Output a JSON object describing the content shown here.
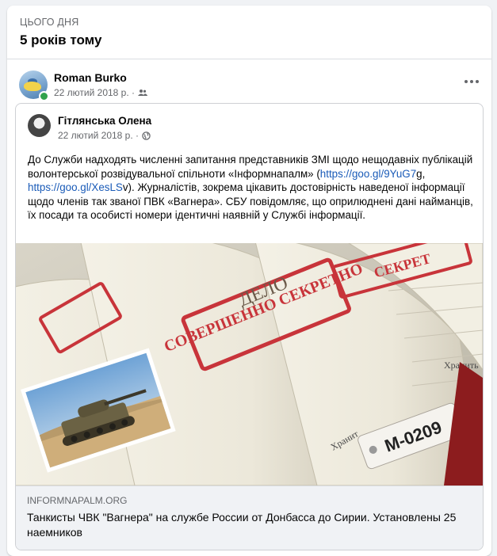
{
  "memories": {
    "eyebrow": "ЦЬОГО ДНЯ",
    "years_ago": "5 років тому"
  },
  "post": {
    "author": "Roman Burko",
    "date": "22 лютий 2018 р. ·",
    "audience_icon": "friends-icon",
    "more_icon": "more-horizontal-icon"
  },
  "shared_post": {
    "author": "Гітлянська Олена",
    "date": "22 лютий 2018 р. ·",
    "audience_icon": "globe-icon",
    "text_part1": "До Служби надходять  численні запитання представників ЗМІ щодо нещодавніх публікацій волонтерської розвідувальної спільноти «Інформнапалм» (",
    "link1": "https://goo.gl/9YuG7",
    "text_part2": "g, ",
    "link2": "https://goo.gl/XesLS",
    "text_part3": "v). Журналістів, зокрема цікавить достовірність наведеної інформації щодо членів так званої ПВК «Вагнера».  СБУ повідомляє, що оприлюднені дані найманців, їх посади та особисті номери ідентичні наявній у Службі інформації."
  },
  "image": {
    "stamp1": "СОВЕРШЕННО СЕКРЕТНО",
    "stamp2": "ДЕЛО",
    "stamp3": "СЕКРЕТ",
    "keep1": "Хранить",
    "keep2": "Хранит",
    "tag": "М-0209"
  },
  "link_preview": {
    "domain": "INFORMNAPALM.ORG",
    "title": "Танкисты ЧВК \"Вагнера\" на службе России от Донбасса до Сирии. Установлены 25 наемников"
  },
  "colors": {
    "link": "#1a5bb8",
    "stamp_red": "#c8343a",
    "online": "#31a24c"
  }
}
